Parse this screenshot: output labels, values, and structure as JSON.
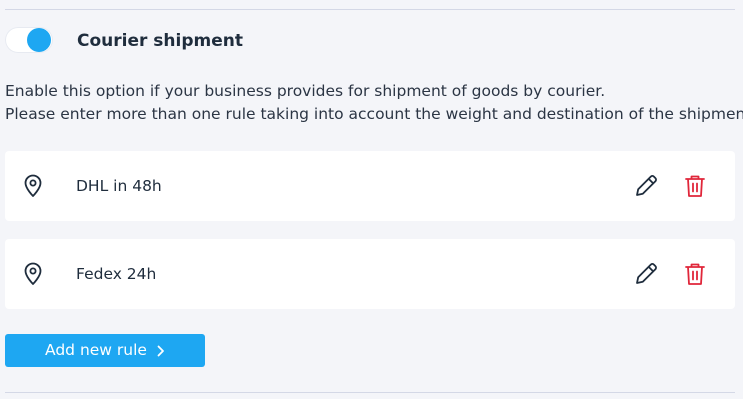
{
  "courier": {
    "enabled": true,
    "title": "Courier shipment",
    "description": [
      "Enable this option if your business provides for shipment of goods by courier.",
      "Please enter more than one rule taking into account the weight and destination of the shipment."
    ]
  },
  "rules": [
    {
      "label": "DHL in 48h",
      "icon": "location-pin-icon"
    },
    {
      "label": "Fedex 24h",
      "icon": "location-pin-icon"
    }
  ],
  "actions": {
    "add_rule_label": "Add new rule",
    "edit_icon": "pencil-icon",
    "delete_icon": "trash-icon"
  },
  "colors": {
    "accent": "#1ea7f2",
    "danger": "#e0263a",
    "background": "#f4f5f9",
    "text": "#1f2d3d"
  }
}
